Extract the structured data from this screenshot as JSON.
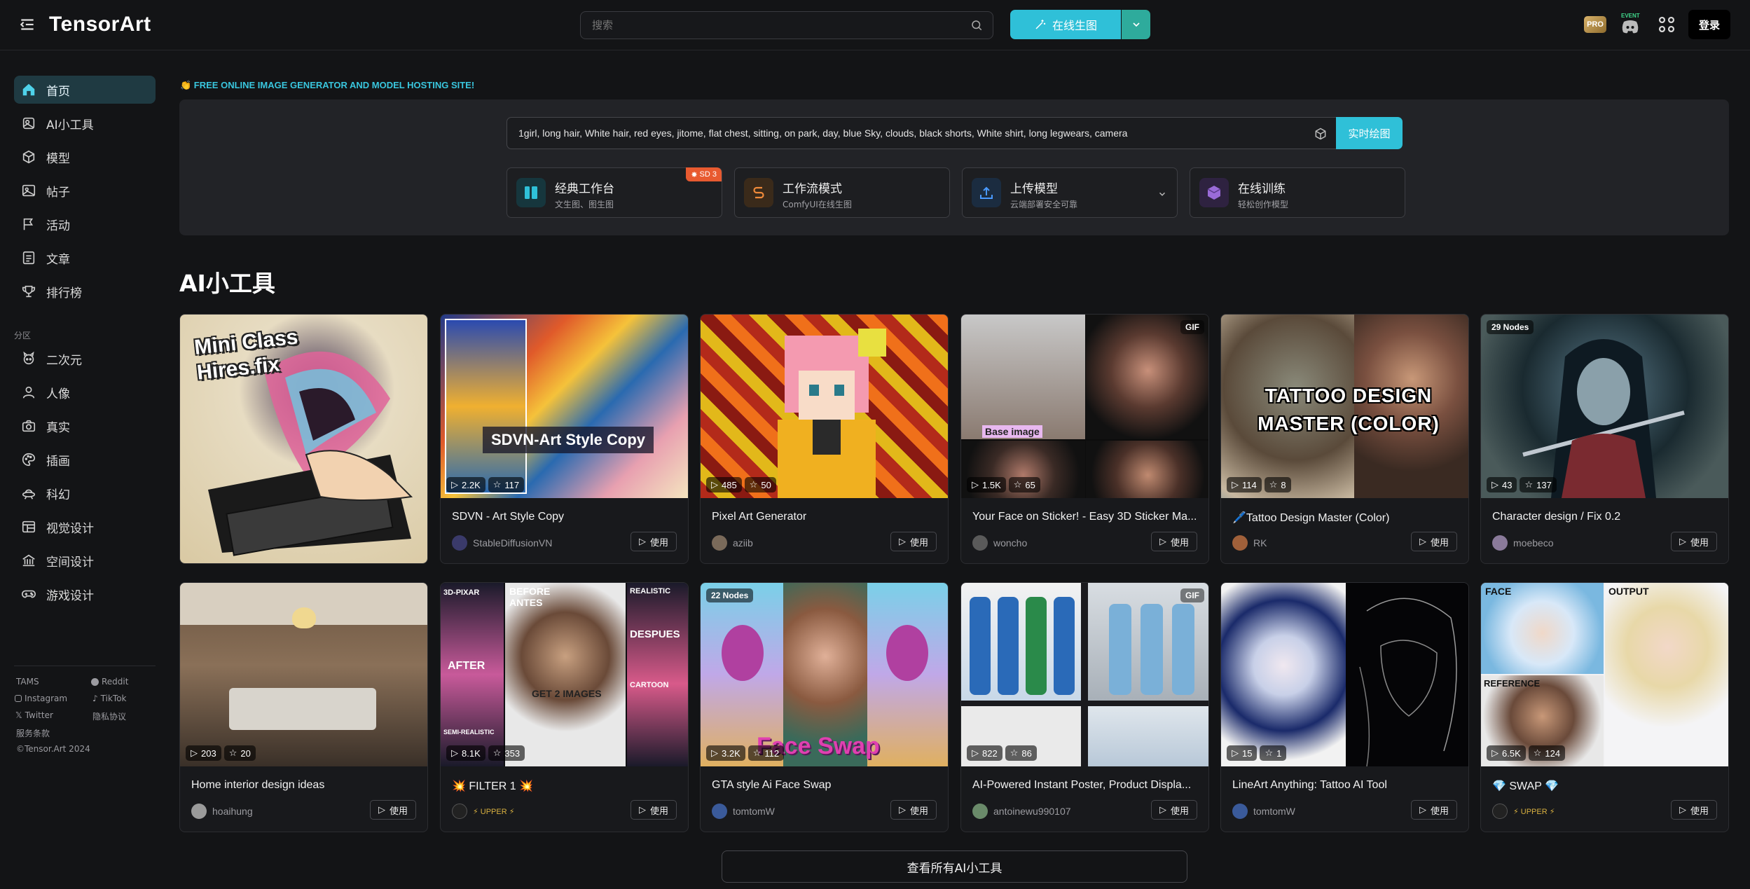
{
  "header": {
    "logo": "TensorArt",
    "search_placeholder": "搜索",
    "generate_label": "在线生图",
    "pro_label": "PRO",
    "event_label": "EVENT",
    "login_label": "登录"
  },
  "sidebar": {
    "items": [
      {
        "label": "首页",
        "icon": "home-icon",
        "active": true
      },
      {
        "label": "AI小工具",
        "icon": "tools-icon"
      },
      {
        "label": "模型",
        "icon": "cube-icon"
      },
      {
        "label": "帖子",
        "icon": "image-icon"
      },
      {
        "label": "活动",
        "icon": "flag-icon"
      },
      {
        "label": "文章",
        "icon": "document-icon"
      },
      {
        "label": "排行榜",
        "icon": "trophy-icon"
      }
    ],
    "zone_label": "分区",
    "zones": [
      {
        "label": "二次元",
        "icon": "anime-icon"
      },
      {
        "label": "人像",
        "icon": "person-icon"
      },
      {
        "label": "真实",
        "icon": "camera-icon"
      },
      {
        "label": "插画",
        "icon": "palette-icon"
      },
      {
        "label": "科幻",
        "icon": "spaceship-icon"
      },
      {
        "label": "视觉设计",
        "icon": "layout-icon"
      },
      {
        "label": "空间设计",
        "icon": "building-icon"
      },
      {
        "label": "游戏设计",
        "icon": "gamepad-icon"
      }
    ],
    "footer": {
      "tams": "TAMS",
      "reddit": "Reddit",
      "instagram": "Instagram",
      "tiktok": "TikTok",
      "twitter": "Twitter",
      "privacy": "隐私协议",
      "terms": "服务条款",
      "copyright": "©Tensor.Art 2024"
    }
  },
  "hero": {
    "tagline": "👏 FREE ONLINE IMAGE GENERATOR AND MODEL HOSTING SITE!",
    "prompt": "1girl, long hair, White hair, red eyes, jitome, flat chest, sitting, on park, day, blue Sky, clouds, black shorts, White shirt, long legwears, camera",
    "draw_label": "实时绘图",
    "tools": [
      {
        "title": "经典工作台",
        "subtitle": "文生图、图生图",
        "badge": "SD 3",
        "icon": "workbench-icon"
      },
      {
        "title": "工作流模式",
        "subtitle": "ComfyUI在线生图",
        "icon": "workflow-icon"
      },
      {
        "title": "上传模型",
        "subtitle": "云端部署安全可靠",
        "icon": "upload-icon"
      },
      {
        "title": "在线训练",
        "subtitle": "轻松创作模型",
        "icon": "train-icon"
      }
    ]
  },
  "section_title": "AI小工具",
  "cards_row1": [
    {
      "title": "",
      "thumb_text": "Mini Class Hires.fix",
      "big": true
    },
    {
      "title": "SDVN - Art Style Copy",
      "author": "StableDiffusionVN",
      "runs": "2.2K",
      "stars": "117",
      "thumb_text": "SDVN-Art Style Copy"
    },
    {
      "title": "Pixel Art Generator",
      "author": "aziib",
      "runs": "485",
      "stars": "50"
    },
    {
      "title": "Your Face on Sticker! - Easy 3D Sticker Ma...",
      "author": "woncho",
      "runs": "1.5K",
      "stars": "65",
      "badge_tr": "GIF",
      "thumb_text": "Base image"
    },
    {
      "title": "🖊️Tattoo Design Master (Color)",
      "author": "RK",
      "runs": "114",
      "stars": "8",
      "thumb_text": "TATTOO DESIGN MASTER (COLOR)"
    },
    {
      "title": "Character design / Fix 0.2",
      "author": "moebeco",
      "runs": "43",
      "stars": "137",
      "badge_tl": "29 Nodes"
    }
  ],
  "cards_row2": [
    {
      "title": "Home interior design ideas",
      "author": "hoaihung",
      "runs": "203",
      "stars": "20"
    },
    {
      "title": "💥 FILTER 1 💥",
      "author": "⚡ UPPER ⚡",
      "runs": "8.1K",
      "stars": "353",
      "thumb_labels": [
        "3D-PIXAR",
        "BEFORE ANTES",
        "REALISTIC",
        "AFTER",
        "GET 2 IMAGES",
        "DESPUES",
        "SEMI-REALISTIC",
        "CARTOON"
      ]
    },
    {
      "title": "GTA style Ai Face Swap",
      "author": "tomtomW",
      "runs": "3.2K",
      "stars": "112",
      "badge_tl": "22 Nodes",
      "thumb_text": "Face Swap"
    },
    {
      "title": "AI-Powered Instant Poster, Product Displa...",
      "author": "antoinewu990107",
      "runs": "822",
      "stars": "86",
      "badge_tr": "GIF"
    },
    {
      "title": "LineArt Anything: Tattoo AI Tool",
      "author": "tomtomW",
      "runs": "15",
      "stars": "1"
    },
    {
      "title": "💎 SWAP 💎",
      "author": "⚡ UPPER ⚡",
      "runs": "6.5K",
      "stars": "124",
      "thumb_labels": [
        "FACE",
        "OUTPUT",
        "REFERENCE"
      ]
    }
  ],
  "use_label": "使用",
  "view_all_label": "查看所有AI小工具",
  "colors": {
    "accent": "#2fc0d8",
    "accent_dark": "#2eab9c",
    "bg": "#131416",
    "panel": "#222327"
  }
}
